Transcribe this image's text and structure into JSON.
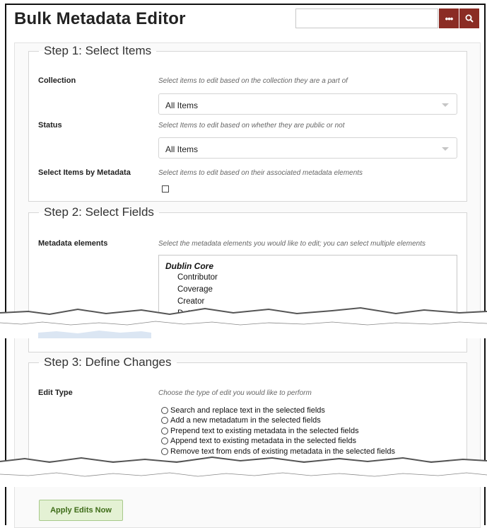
{
  "header": {
    "title": "Bulk Metadata Editor",
    "search_value": "",
    "more_icon": "ellipsis-icon",
    "search_icon": "search-icon",
    "accent_color": "#8b2c24"
  },
  "step1": {
    "legend": "Step 1: Select Items",
    "collection": {
      "label": "Collection",
      "help": "Select items to edit based on the collection they are a part of",
      "selected": "All Items"
    },
    "status": {
      "label": "Status",
      "help": "Select Items to edit based on whether they are public or not",
      "selected": "All Items"
    },
    "by_metadata": {
      "label": "Select Items by Metadata",
      "help": "Select items to edit based on their associated metadata elements",
      "checked": false
    }
  },
  "step2": {
    "legend": "Step 2: Select Fields",
    "metadata": {
      "label": "Metadata elements",
      "help": "Select the metadata elements you would like to edit; you can select multiple elements",
      "group": "Dublin Core",
      "options": [
        "Contributor",
        "Coverage",
        "Creator",
        "Date"
      ]
    }
  },
  "step3": {
    "legend": "Step 3: Define Changes",
    "edit_type": {
      "label": "Edit Type",
      "help": "Choose the type of edit you would like to perform",
      "options": [
        "Search and replace text in the selected fields",
        "Add a new metadatum in the selected fields",
        "Prepend text to existing metadata in the selected fields",
        "Append text to existing metadata in the selected fields",
        "Remove text from ends of existing metadata in the selected fields"
      ]
    }
  },
  "actions": {
    "apply_label": "Apply Edits Now",
    "apply_color": "#e4f1d4"
  }
}
